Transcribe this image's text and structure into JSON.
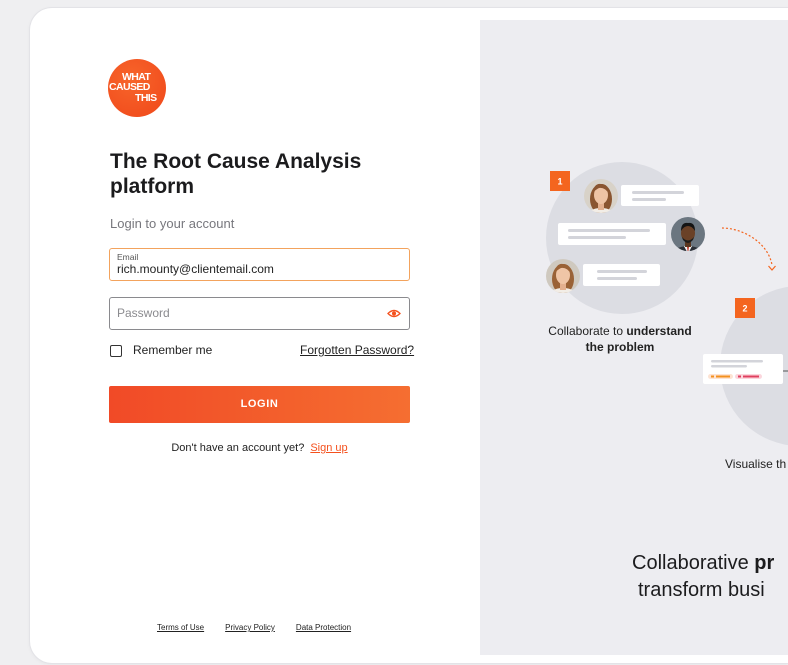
{
  "brand": {
    "logo_line1": "WHAT",
    "logo_line2": "CAUSED",
    "logo_line3": "THIS",
    "accent_color": "#f4511e"
  },
  "login": {
    "title_line1": "The Root Cause Analysis",
    "title_line2": "platform",
    "subtitle": "Login to your account",
    "email": {
      "label": "Email",
      "value": "rich.mounty@clientemail.com"
    },
    "password": {
      "placeholder": "Password",
      "toggle_icon": "eye-icon"
    },
    "remember_me": {
      "label": "Remember me",
      "checked": false
    },
    "forgot_password": "Forgotten Password?",
    "submit_label": "LOGIN",
    "signup_prompt": "Don't have an account yet?",
    "signup_link": "Sign up"
  },
  "footer": {
    "terms": "Terms of Use",
    "privacy": "Privacy Policy",
    "data_protection": "Data Protection"
  },
  "illustration": {
    "step1": {
      "badge": "1",
      "caption_line1_regular": "Collaborate to ",
      "caption_line1_bold": "understand",
      "caption_line2_bold": "the problem"
    },
    "step2": {
      "badge": "2",
      "caption": "Visualise th"
    },
    "tagline": {
      "line1_regular": "Collaborative ",
      "line1_bold": "pr",
      "line2": "transform busi"
    }
  },
  "colors": {
    "accent": "#f4511e",
    "panel_background": "#ededf1",
    "focused_field_border": "#f3a35d"
  }
}
